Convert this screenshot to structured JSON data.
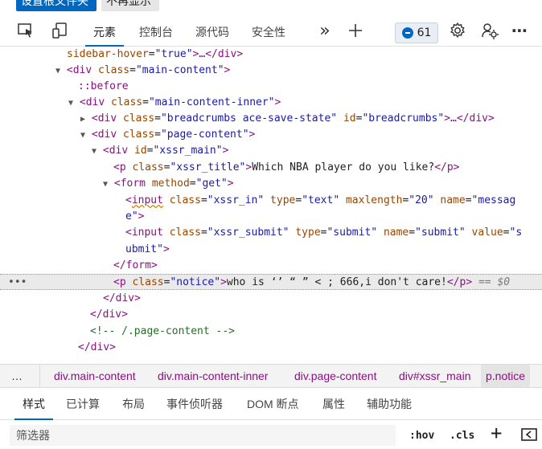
{
  "infobar": {
    "primary_button": "设置根文件夹",
    "secondary_button": "不再显示"
  },
  "toolbar": {
    "icons": [
      "inspect-element-icon",
      "device-emulation-icon"
    ],
    "tabs": [
      {
        "label": "元素",
        "active": true
      },
      {
        "label": "控制台",
        "active": false
      },
      {
        "label": "源代码",
        "active": false
      },
      {
        "label": "安全性",
        "active": false
      }
    ],
    "more_tabs": "»",
    "add_tab": "+",
    "issues_count": "61",
    "more_menu": "⋯"
  },
  "dom": {
    "l0_attr": "sidebar-hover",
    "l0_val": "\"true\"",
    "l0_rest": ">…</",
    "l0_tag": "div",
    "l1_tag": "div",
    "l1_attr": "class",
    "l1_val": "\"main-content\"",
    "l2_pseudo": "::before",
    "l3_tag": "div",
    "l3_attr": "class",
    "l3_val": "\"main-content-inner\"",
    "l4_tag": "div",
    "l4_attr1": "class",
    "l4_val1": "\"breadcrumbs ace-save-state\"",
    "l4_attr2": "id",
    "l4_val2": "\"breadcrumbs\"",
    "l4_rest": ">…</",
    "l5_tag": "div",
    "l5_attr": "class",
    "l5_val": "\"page-content\"",
    "l6_tag": "div",
    "l6_attr": "id",
    "l6_val": "\"xssr_main\"",
    "l7_tag": "p",
    "l7_attr": "class",
    "l7_val": "\"xssr_title\"",
    "l7_text": "Which NBA player do you like?",
    "l8_tag": "form",
    "l8_attr": "method",
    "l8_val": "\"get\"",
    "l9_tag": "input",
    "l9_attr1": "class",
    "l9_val1": "\"xssr_in\"",
    "l9_attr2": "type",
    "l9_val2": "\"text\"",
    "l9_attr3": "maxlength",
    "l9_val3": "\"20\"",
    "l9_attr4": "name",
    "l9_val4": "\"messag",
    "l10_cont": "e\"",
    "l11_tag": "input",
    "l11_attr1": "class",
    "l11_val1": "\"xssr_submit\"",
    "l11_attr2": "type",
    "l11_val2": "\"submit\"",
    "l11_attr3": "name",
    "l11_val3": "\"submit\"",
    "l11_attr4": "value",
    "l11_val4": "\"s",
    "l12_cont": "ubmit\"",
    "l13_tag": "form",
    "l14_tag": "p",
    "l14_attr": "class",
    "l14_val": "\"notice\"",
    "l14_text": "who is ‘’ “ ” < ; 666,i don't care!",
    "l14_eq": "== $0",
    "l15_tag": "div",
    "l16_tag": "div",
    "l17_comment": "<!-- /.page-content -->",
    "l18_tag": "div"
  },
  "breadcrumbs": {
    "more": "…",
    "items": [
      "div.main-content",
      "div.main-content-inner",
      "div.page-content",
      "div#xssr_main",
      "p.notice"
    ]
  },
  "subtabs": [
    "样式",
    "已计算",
    "布局",
    "事件侦听器",
    "DOM 断点",
    "属性",
    "辅助功能"
  ],
  "filter": {
    "placeholder": "筛选器",
    "hov": ":hov",
    "cls": ".cls",
    "add": "+"
  }
}
